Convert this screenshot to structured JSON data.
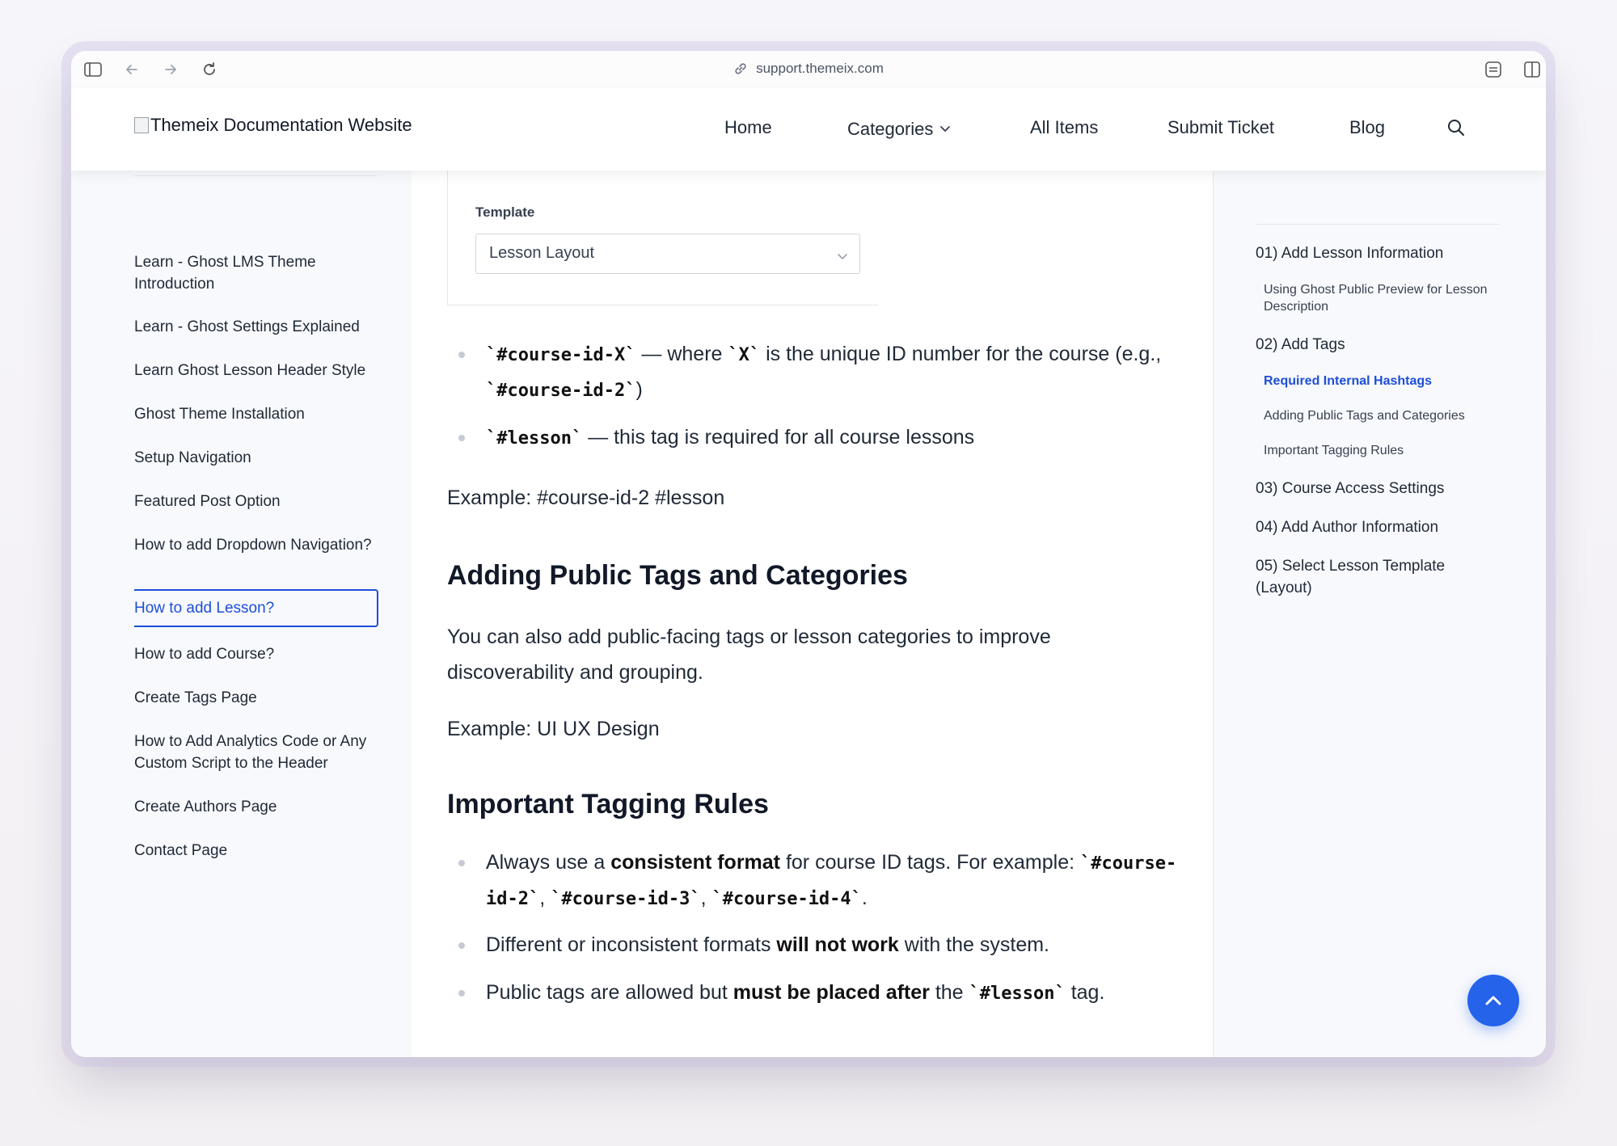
{
  "browser": {
    "url": "support.themeix.com"
  },
  "header": {
    "logo_alt": "Themeix Documentation Website",
    "nav": {
      "home": "Home",
      "categories": "Categories",
      "all_items": "All Items",
      "submit_ticket": "Submit Ticket",
      "blog": "Blog"
    }
  },
  "sidebar": {
    "items": [
      "Learn - Ghost LMS Theme Introduction",
      "Learn - Ghost Settings Explained",
      "Learn Ghost Lesson Header Style",
      "Ghost Theme Installation",
      "Setup Navigation",
      "Featured Post Option",
      "How to add Dropdown Navigation?",
      "How to add Lesson?",
      "How to add Course?",
      "Create Tags Page",
      "How to Add Analytics Code or Any Custom Script to the Header",
      "Create Authors Page",
      "Contact Page"
    ],
    "active_index": 7
  },
  "main": {
    "template_label": "Template",
    "template_value": "Lesson Layout",
    "bullets1": {
      "b1_code1": "`#course-id-X`",
      "b1_t1": " — where ",
      "b1_code2": "`X`",
      "b1_t2": " is the unique ID number for the course (e.g., ",
      "b1_code3": "`#course-id-2`",
      "b1_t3": ")",
      "b2_code": "`#lesson`",
      "b2_t": " — this tag is required for all course lessons"
    },
    "example1": "Example: #course-id-2 #lesson",
    "heading1": "Adding Public Tags and Categories",
    "para1": "You can also add public-facing tags or lesson categories to improve discoverability and grouping.",
    "example2": "Example: UI UX Design",
    "heading2": "Important Tagging Rules",
    "rules": {
      "r1_t1": "Always use a ",
      "r1_s": "consistent format",
      "r1_t2": " for course ID tags. For example: ",
      "r1_c1": "`#course-id-2`",
      "r1_sep1": ", ",
      "r1_c2": "`#course-id-3`",
      "r1_sep2": ", ",
      "r1_c3": "`#course-id-4`",
      "r1_t3": ".",
      "r2_t1": "Different or inconsistent formats ",
      "r2_s": "will not work",
      "r2_t2": " with the system.",
      "r3_t1": "Public tags are allowed but ",
      "r3_s": "must be placed after",
      "r3_t2": " the ",
      "r3_c": "`#lesson`",
      "r3_t3": " tag."
    }
  },
  "toc": {
    "i1": "01) Add Lesson Information",
    "i1a": "Using Ghost Public Preview for Lesson Description",
    "i2": "02) Add Tags",
    "i2a": "Required Internal Hashtags",
    "i2b": "Adding Public Tags and Categories",
    "i2c": "Important Tagging Rules",
    "i3": "03) Course Access Settings",
    "i4": "04) Add Author Information",
    "i5": "05) Select Lesson Template (Layout)"
  },
  "colors": {
    "accent": "#2563eb",
    "link_active": "#1d4ed8"
  },
  "icons": [
    "sidebar-toggle-icon",
    "back-arrow-icon",
    "forward-arrow-icon",
    "reload-icon",
    "link-icon",
    "extension-icon",
    "split-view-icon",
    "chevron-down-icon",
    "search-icon",
    "chevron-up-icon"
  ]
}
